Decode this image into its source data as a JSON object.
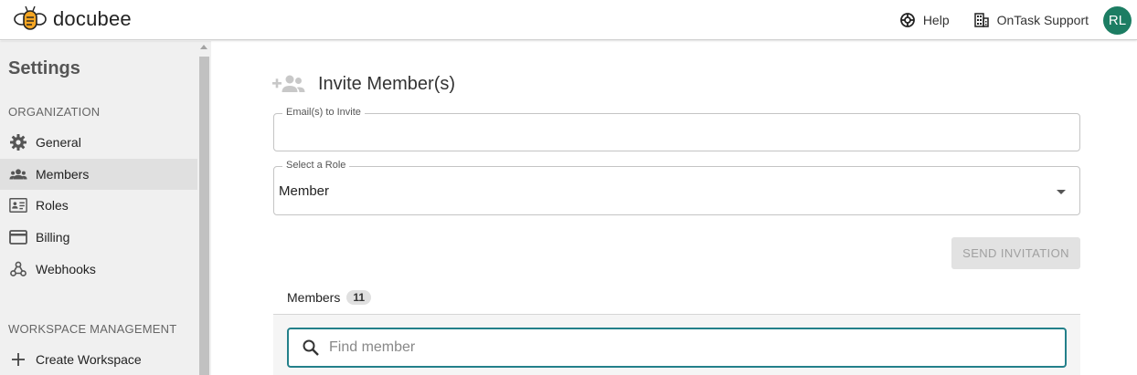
{
  "header": {
    "logo_text": "docubee",
    "help_label": "Help",
    "org_label": "OnTask Support",
    "avatar_initials": "RL",
    "avatar_color": "#1c7d63"
  },
  "sidebar": {
    "title": "Settings",
    "org_section": "ORGANIZATION",
    "items": [
      {
        "label": "General",
        "icon": "gear-icon"
      },
      {
        "label": "Members",
        "icon": "people-icon",
        "active": true
      },
      {
        "label": "Roles",
        "icon": "id-card-icon"
      },
      {
        "label": "Billing",
        "icon": "credit-card-icon"
      },
      {
        "label": "Webhooks",
        "icon": "webhook-icon"
      }
    ],
    "workspace_section": "WORKSPACE MANAGEMENT",
    "workspace_items": [
      {
        "label": "Create Workspace",
        "icon": "plus-icon"
      }
    ]
  },
  "invite": {
    "title": "Invite Member(s)",
    "email_label": "Email(s) to Invite",
    "email_value": "",
    "role_label": "Select a Role",
    "role_value": "Member",
    "send_label": "SEND INVITATION"
  },
  "members": {
    "tab_label": "Members",
    "count": "11",
    "search_placeholder": "Find member"
  },
  "colors": {
    "accent": "#23808a",
    "sidebar_bg": "#f0f0f0",
    "active_bg": "#e0e0e0"
  }
}
